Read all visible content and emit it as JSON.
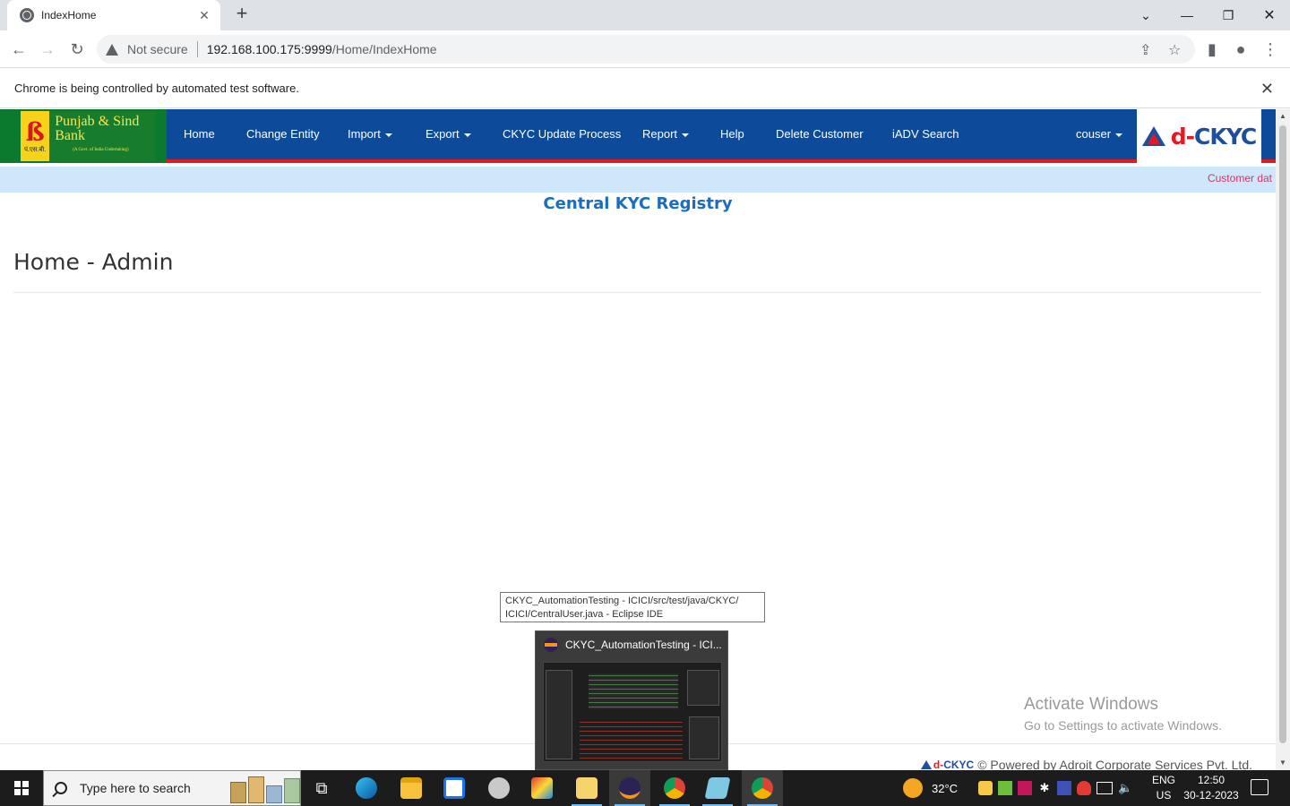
{
  "browser": {
    "tab_title": "IndexHome",
    "new_tab": "+",
    "security_label": "Not secure",
    "url_host": "192.168.100.175:9999",
    "url_path": "/Home/IndexHome",
    "infobar_text": "Chrome is being controlled by automated test software."
  },
  "header": {
    "bank_name": "Punjab & Sind Bank",
    "bank_tagline": "(A Govt. of India Undertaking)",
    "emblem_sub": "पं.एस.बी.",
    "nav": {
      "home": "Home",
      "change_entity": "Change Entity",
      "import": "Import",
      "export": "Export",
      "ckyc_update": "CKYC Update Process",
      "report": "Report",
      "help": "Help",
      "delete_customer": "Delete Customer",
      "iadv_search": "iADV Search",
      "user": "couser"
    },
    "brand_prefix": "d-",
    "brand_suffix": "CKYC"
  },
  "marquee_text": "Customer dat",
  "main": {
    "registry_title": "Central KYC Registry",
    "page_heading": "Home - Admin"
  },
  "footer": {
    "brand_prefix": "d-",
    "brand_suffix": "CKYC",
    "powered_by": "© Powered by Adroit Corporate Services Pvt. Ltd."
  },
  "watermark": {
    "line1": "Activate Windows",
    "line2": "Go to Settings to activate Windows."
  },
  "taskbar_preview": {
    "tooltip_line1": "CKYC_AutomationTesting - ICICI/src/test/java/CKYC/",
    "tooltip_line2": "ICICI/CentralUser.java - Eclipse IDE",
    "title": "CKYC_AutomationTesting - ICI..."
  },
  "taskbar": {
    "search_placeholder": "Type here to search",
    "weather": "32°C",
    "lang_1": "ENG",
    "lang_2": "US",
    "time": "12:50",
    "date": "30-12-2023"
  }
}
